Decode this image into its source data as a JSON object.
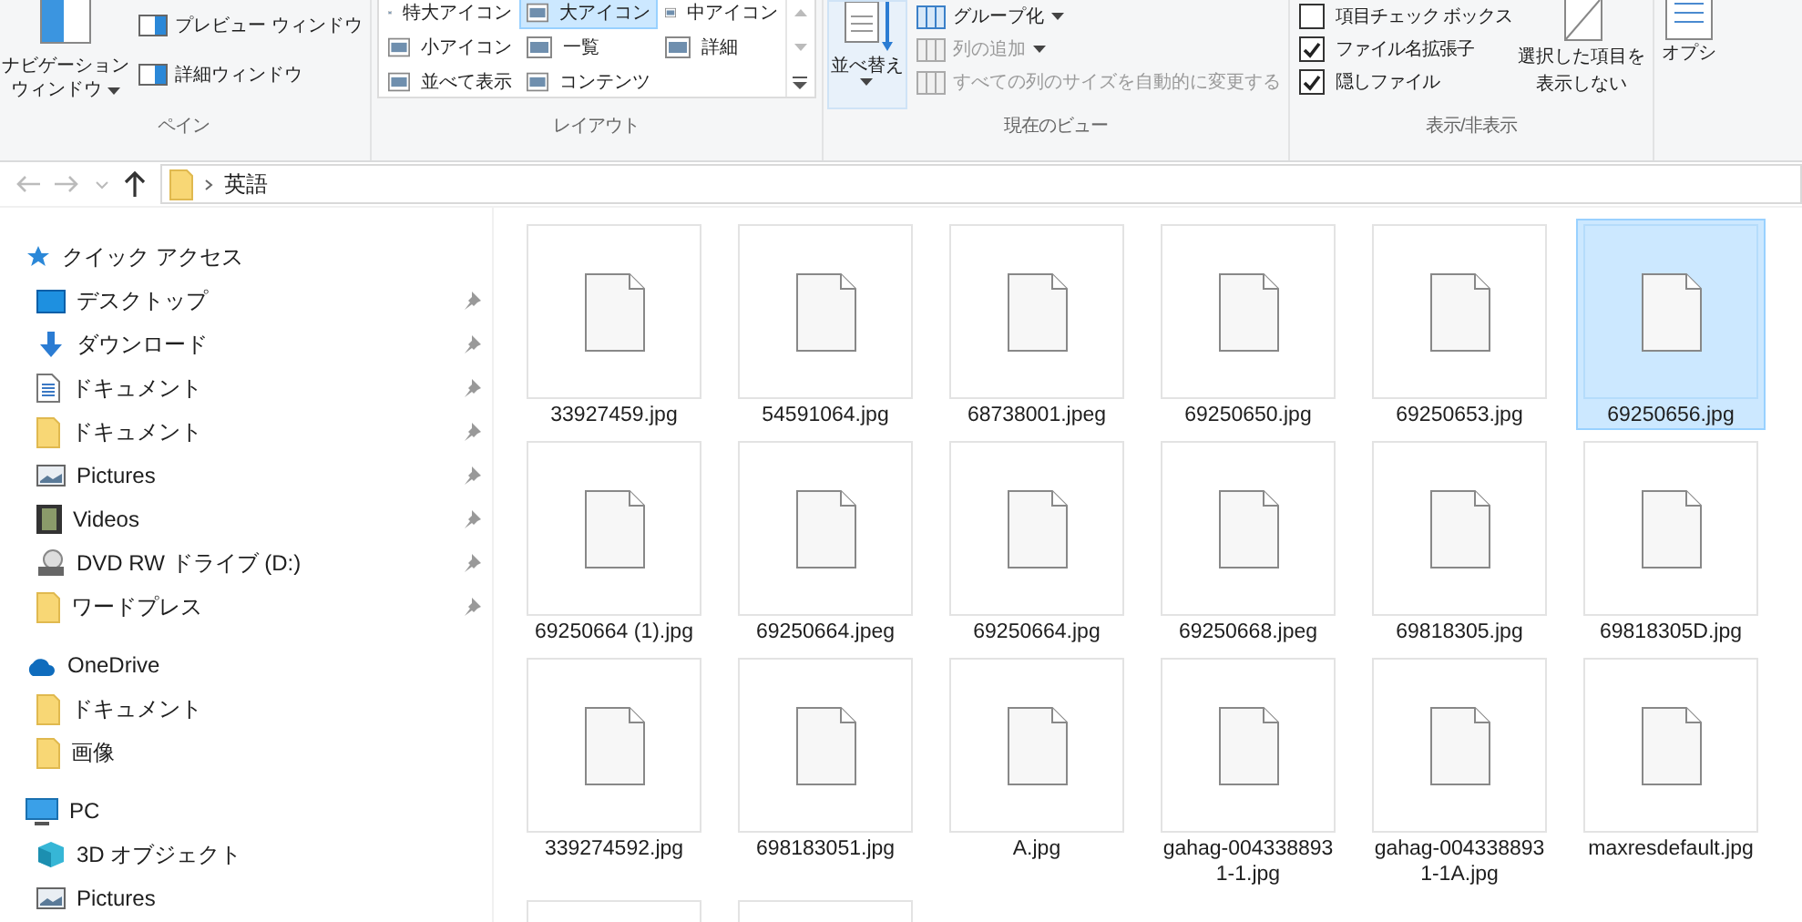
{
  "ribbon": {
    "pane": {
      "label": "ペイン",
      "nav_button": [
        "ナビゲーション",
        "ウィンドウ"
      ],
      "items": [
        "プレビュー ウィンドウ",
        "詳細ウィンドウ"
      ]
    },
    "layout": {
      "label": "レイアウト",
      "options": [
        {
          "label": "特大アイコン",
          "selected": false
        },
        {
          "label": "大アイコン",
          "selected": true
        },
        {
          "label": "中アイコン",
          "selected": false
        },
        {
          "label": "小アイコン",
          "selected": false
        },
        {
          "label": "一覧",
          "selected": false
        },
        {
          "label": "詳細",
          "selected": false
        },
        {
          "label": "並べて表示",
          "selected": false
        },
        {
          "label": "コンテンツ",
          "selected": false
        }
      ]
    },
    "current_view": {
      "label": "現在のビュー",
      "sort_button": "並べ替え",
      "items": [
        {
          "label": "グループ化",
          "disabled": false,
          "dropdown": true
        },
        {
          "label": "列の追加",
          "disabled": true,
          "dropdown": true
        },
        {
          "label": "すべての列のサイズを自動的に変更する",
          "disabled": true,
          "dropdown": false
        }
      ]
    },
    "show_hide": {
      "label": "表示/非表示",
      "checkboxes": [
        {
          "label": "項目チェック ボックス",
          "checked": false
        },
        {
          "label": "ファイル名拡張子",
          "checked": true
        },
        {
          "label": "隠しファイル",
          "checked": true
        }
      ],
      "hide_button": [
        "選択した項目を",
        "表示しない"
      ]
    },
    "options_button": "オプシ"
  },
  "address": {
    "path": [
      "英語"
    ]
  },
  "nav": [
    {
      "kind": "section",
      "label": "クイック アクセス"
    },
    {
      "kind": "item",
      "label": "デスクトップ",
      "pinned": true
    },
    {
      "kind": "item",
      "label": "ダウンロード",
      "pinned": true
    },
    {
      "kind": "item",
      "label": "ドキュメント",
      "pinned": true
    },
    {
      "kind": "item",
      "label": "ドキュメント",
      "pinned": true
    },
    {
      "kind": "item",
      "label": "Pictures",
      "pinned": true
    },
    {
      "kind": "item",
      "label": "Videos",
      "pinned": true
    },
    {
      "kind": "item",
      "label": "DVD RW ドライブ (D:)",
      "pinned": true
    },
    {
      "kind": "item",
      "label": "ワードプレス",
      "pinned": true
    },
    {
      "kind": "section",
      "label": "OneDrive"
    },
    {
      "kind": "item",
      "label": "ドキュメント",
      "pinned": false
    },
    {
      "kind": "item",
      "label": "画像",
      "pinned": false
    },
    {
      "kind": "section",
      "label": "PC"
    },
    {
      "kind": "item",
      "label": "3D オブジェクト",
      "pinned": false
    },
    {
      "kind": "item",
      "label": "Pictures",
      "pinned": false
    }
  ],
  "files": [
    {
      "name": "33927459.jpg",
      "selected": false
    },
    {
      "name": "54591064.jpg",
      "selected": false
    },
    {
      "name": "68738001.jpeg",
      "selected": false
    },
    {
      "name": "69250650.jpg",
      "selected": false
    },
    {
      "name": "69250653.jpg",
      "selected": false
    },
    {
      "name": "69250656.jpg",
      "selected": true
    },
    {
      "name": "69250664 (1).jpg",
      "selected": false
    },
    {
      "name": "69250664.jpeg",
      "selected": false
    },
    {
      "name": "69250664.jpg",
      "selected": false
    },
    {
      "name": "69250668.jpeg",
      "selected": false
    },
    {
      "name": "69818305.jpg",
      "selected": false
    },
    {
      "name": "69818305D.jpg",
      "selected": false
    },
    {
      "name": "339274592.jpg",
      "selected": false
    },
    {
      "name": "698183051.jpg",
      "selected": false
    },
    {
      "name": "A.jpg",
      "selected": false
    },
    {
      "name": "gahag-0043388931-1.jpg",
      "selected": false
    },
    {
      "name": "gahag-0043388931-1A.jpg",
      "selected": false
    },
    {
      "name": "maxresdefault.jpg",
      "selected": false
    },
    {
      "selected": false
    },
    {
      "selected": false
    }
  ]
}
